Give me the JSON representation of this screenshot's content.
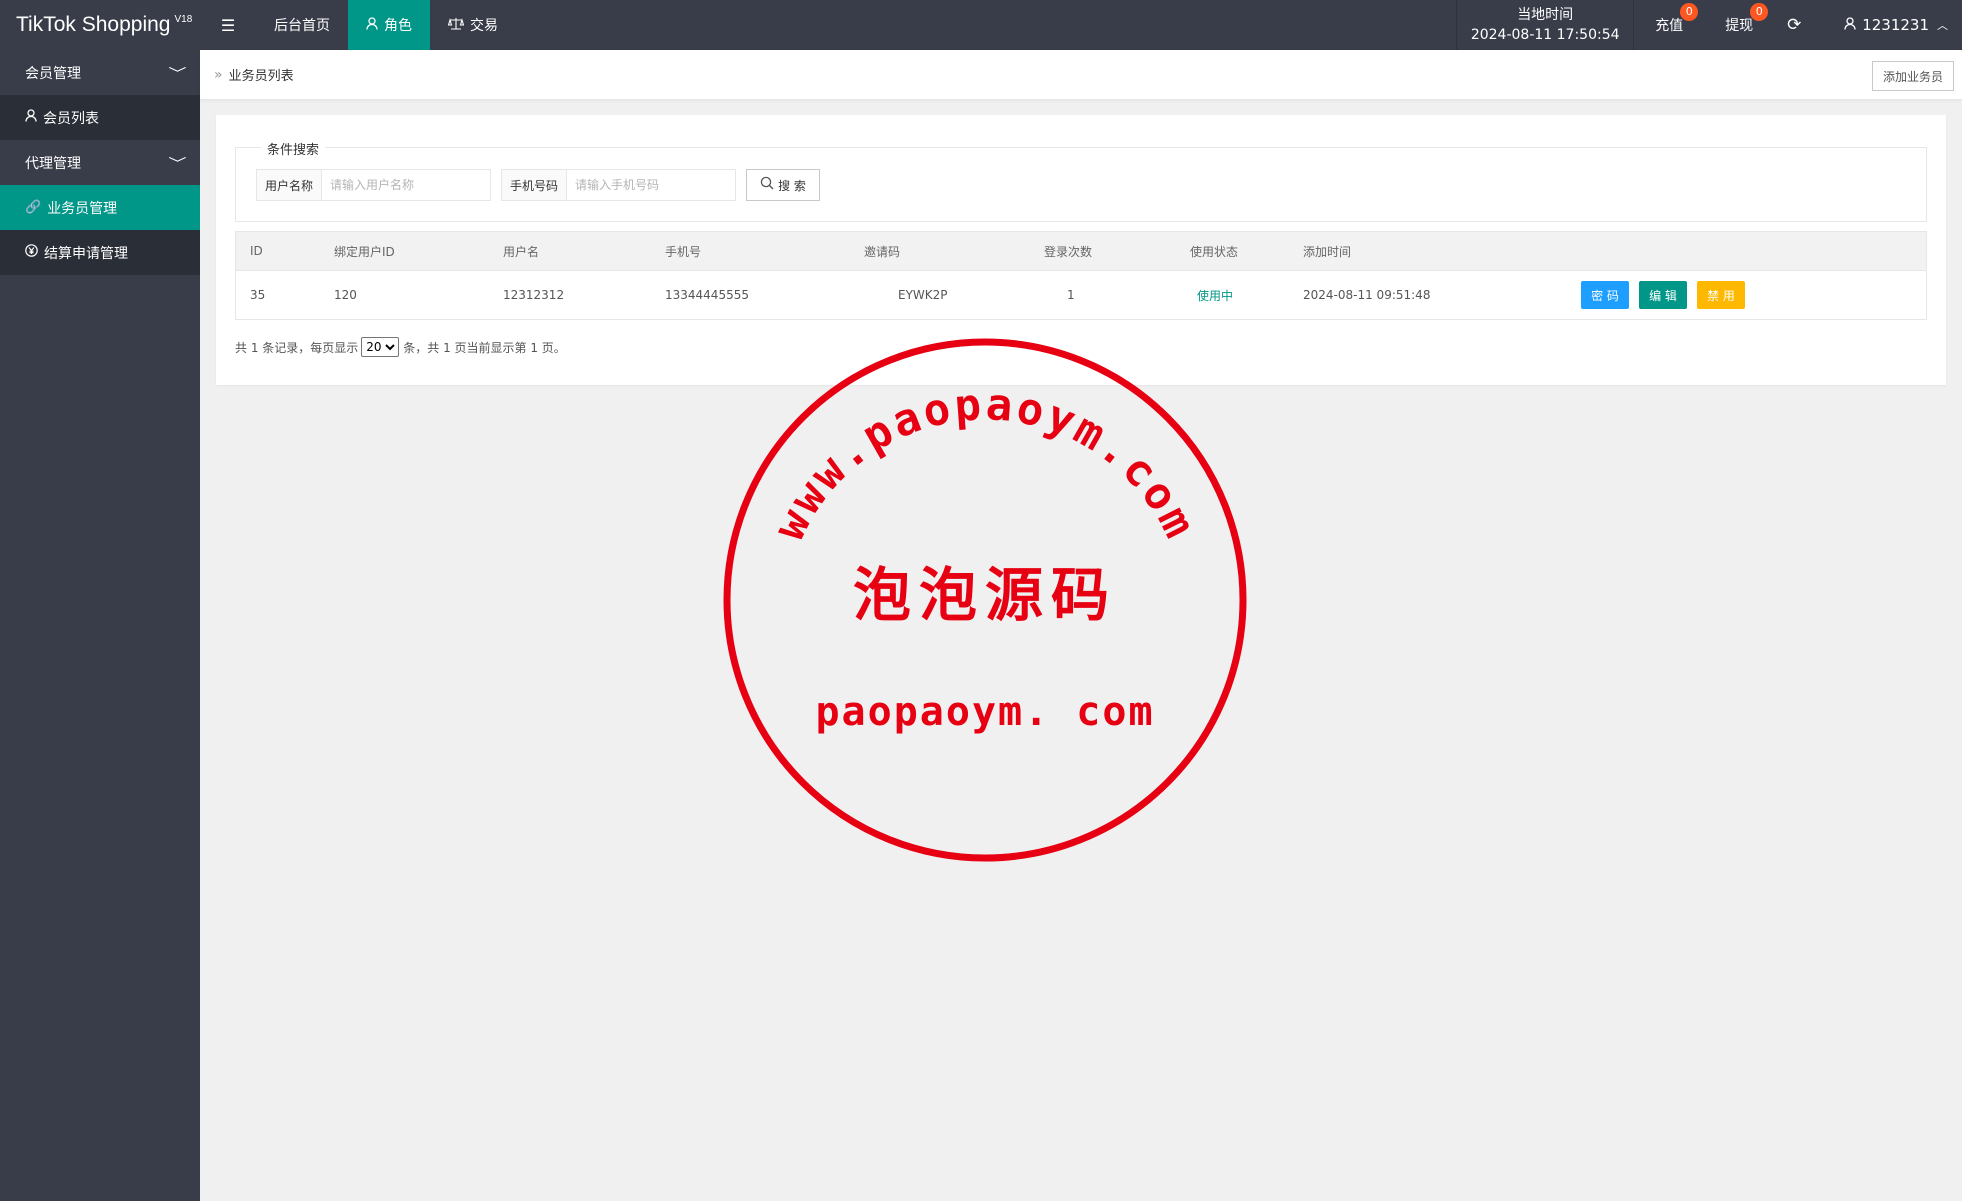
{
  "app": {
    "title": "TikTok Shopping",
    "version": "V18"
  },
  "nav": {
    "menu_toggle_icon": "menu-icon",
    "items": [
      {
        "label": "后台首页",
        "active": false
      },
      {
        "label": "角色",
        "active": true,
        "icon": "user-icon"
      },
      {
        "label": "交易",
        "active": false,
        "icon": "scale-icon"
      }
    ]
  },
  "topright": {
    "clock_label": "当地时间",
    "clock_value": "2024-08-11 17:50:54",
    "recharge_label": "充值",
    "recharge_badge": "0",
    "withdraw_label": "提现",
    "withdraw_badge": "0",
    "refresh_icon": "refresh-icon",
    "username": "1231231"
  },
  "sidebar": {
    "groups": [
      {
        "label": "会员管理",
        "children": [
          {
            "label": "会员列表",
            "icon": "user-icon",
            "active": false
          }
        ]
      },
      {
        "label": "代理管理",
        "children": [
          {
            "label": "业务员管理",
            "icon": "link-icon",
            "active": true
          },
          {
            "label": "结算申请管理",
            "icon": "yen-icon",
            "active": false
          }
        ]
      }
    ]
  },
  "breadcrumb": {
    "current": "业务员列表"
  },
  "toolbar": {
    "add_label": "添加业务员"
  },
  "search": {
    "legend": "条件搜索",
    "username_label": "用户名称",
    "username_placeholder": "请输入用户名称",
    "phone_label": "手机号码",
    "phone_placeholder": "请输入手机号码",
    "button_label": "搜 索"
  },
  "table": {
    "headers": [
      "ID",
      "绑定用户ID",
      "用户名",
      "手机号",
      "邀请码",
      "登录次数",
      "使用状态",
      "添加时间"
    ],
    "rows": [
      {
        "id": "35",
        "bound_user_id": "120",
        "username": "12312312",
        "phone": "13344445555",
        "invite_code": "EYWK2P",
        "login_count": "1",
        "status": "使用中",
        "added_at": "2024-08-11 09:51:48",
        "actions": {
          "password": "密 码",
          "edit": "编 辑",
          "disable": "禁 用"
        }
      }
    ]
  },
  "pager": {
    "prefix": "共 1 条记录，每页显示",
    "page_size": "20",
    "suffix": "条，共 1 页当前显示第 1 页。"
  },
  "watermark": {
    "top_arc": "www.paopaoym.com",
    "center": "泡泡源码",
    "bottom": "paopaoym. com",
    "color": "#e60012"
  }
}
